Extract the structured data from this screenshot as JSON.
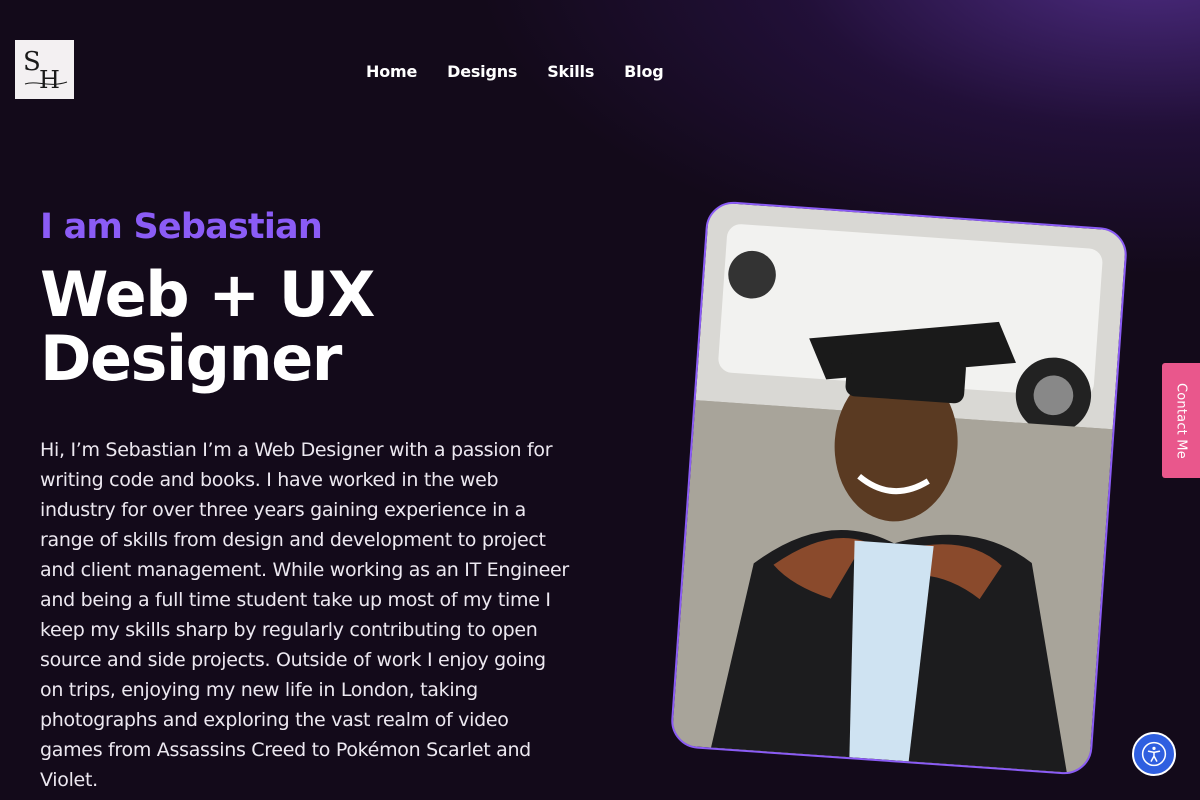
{
  "logo": {
    "letters": "SH"
  },
  "nav": {
    "items": [
      {
        "label": "Home"
      },
      {
        "label": "Designs"
      },
      {
        "label": "Skills"
      },
      {
        "label": "Blog"
      }
    ]
  },
  "hero": {
    "eyebrow": "I am Sebastian",
    "headline_line1": "Web + UX",
    "headline_line2": "Designer",
    "bio": "Hi, I’m Sebastian I’m a Web Designer with a passion for writing code and books. I have worked in the web industry for over three years gaining experience in a range of skills from design and development to project and client management. While working as an IT Engineer and being a full time student take up most of my time I keep my skills sharp by regularly contributing to open source and side projects. Outside of work I enjoy going on trips, enjoying my new life in London, taking photographs and exploring the vast realm of video games from Assassins Creed to Pokémon Scarlet and Violet."
  },
  "contact_tab": {
    "label": "Contact Me"
  },
  "colors": {
    "accent": "#8b5cf6",
    "background": "#130a1a",
    "contact_tab": "#e9578c",
    "accessibility_button": "#2f5fe0"
  },
  "icons": {
    "accessibility": "accessibility-icon"
  }
}
